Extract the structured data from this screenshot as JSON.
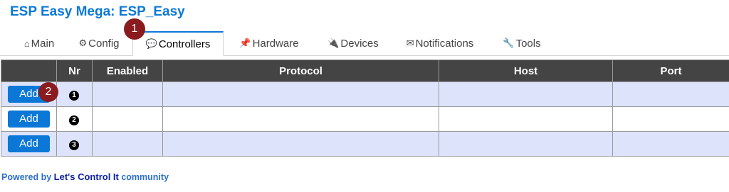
{
  "app": {
    "title": "ESP Easy Mega: ESP_Easy"
  },
  "tabs": [
    {
      "icon": "⌂",
      "label": "Main"
    },
    {
      "icon": "⚙",
      "label": "Config"
    },
    {
      "icon": "💬",
      "label": "Controllers"
    },
    {
      "icon": "📌",
      "label": "Hardware"
    },
    {
      "icon": "🔌",
      "label": "Devices"
    },
    {
      "icon": "✉",
      "label": "Notifications"
    },
    {
      "icon": "🔧",
      "label": "Tools"
    }
  ],
  "annotations": {
    "one": "1",
    "two": "2"
  },
  "table": {
    "headers": [
      "",
      "Nr",
      "Enabled",
      "Protocol",
      "Host",
      "Port"
    ],
    "rows": [
      {
        "button": "Add",
        "nr": "1"
      },
      {
        "button": "Add",
        "nr": "2"
      },
      {
        "button": "Add",
        "nr": "3"
      }
    ]
  },
  "footer": {
    "prefix": "Powered by",
    "link": "Let's Control It",
    "suffix": "community"
  },
  "colors": {
    "accent": "#0b78d8",
    "header_bg": "#444444",
    "row_odd": "#dde3fb",
    "badge": "#8a1b1e"
  }
}
